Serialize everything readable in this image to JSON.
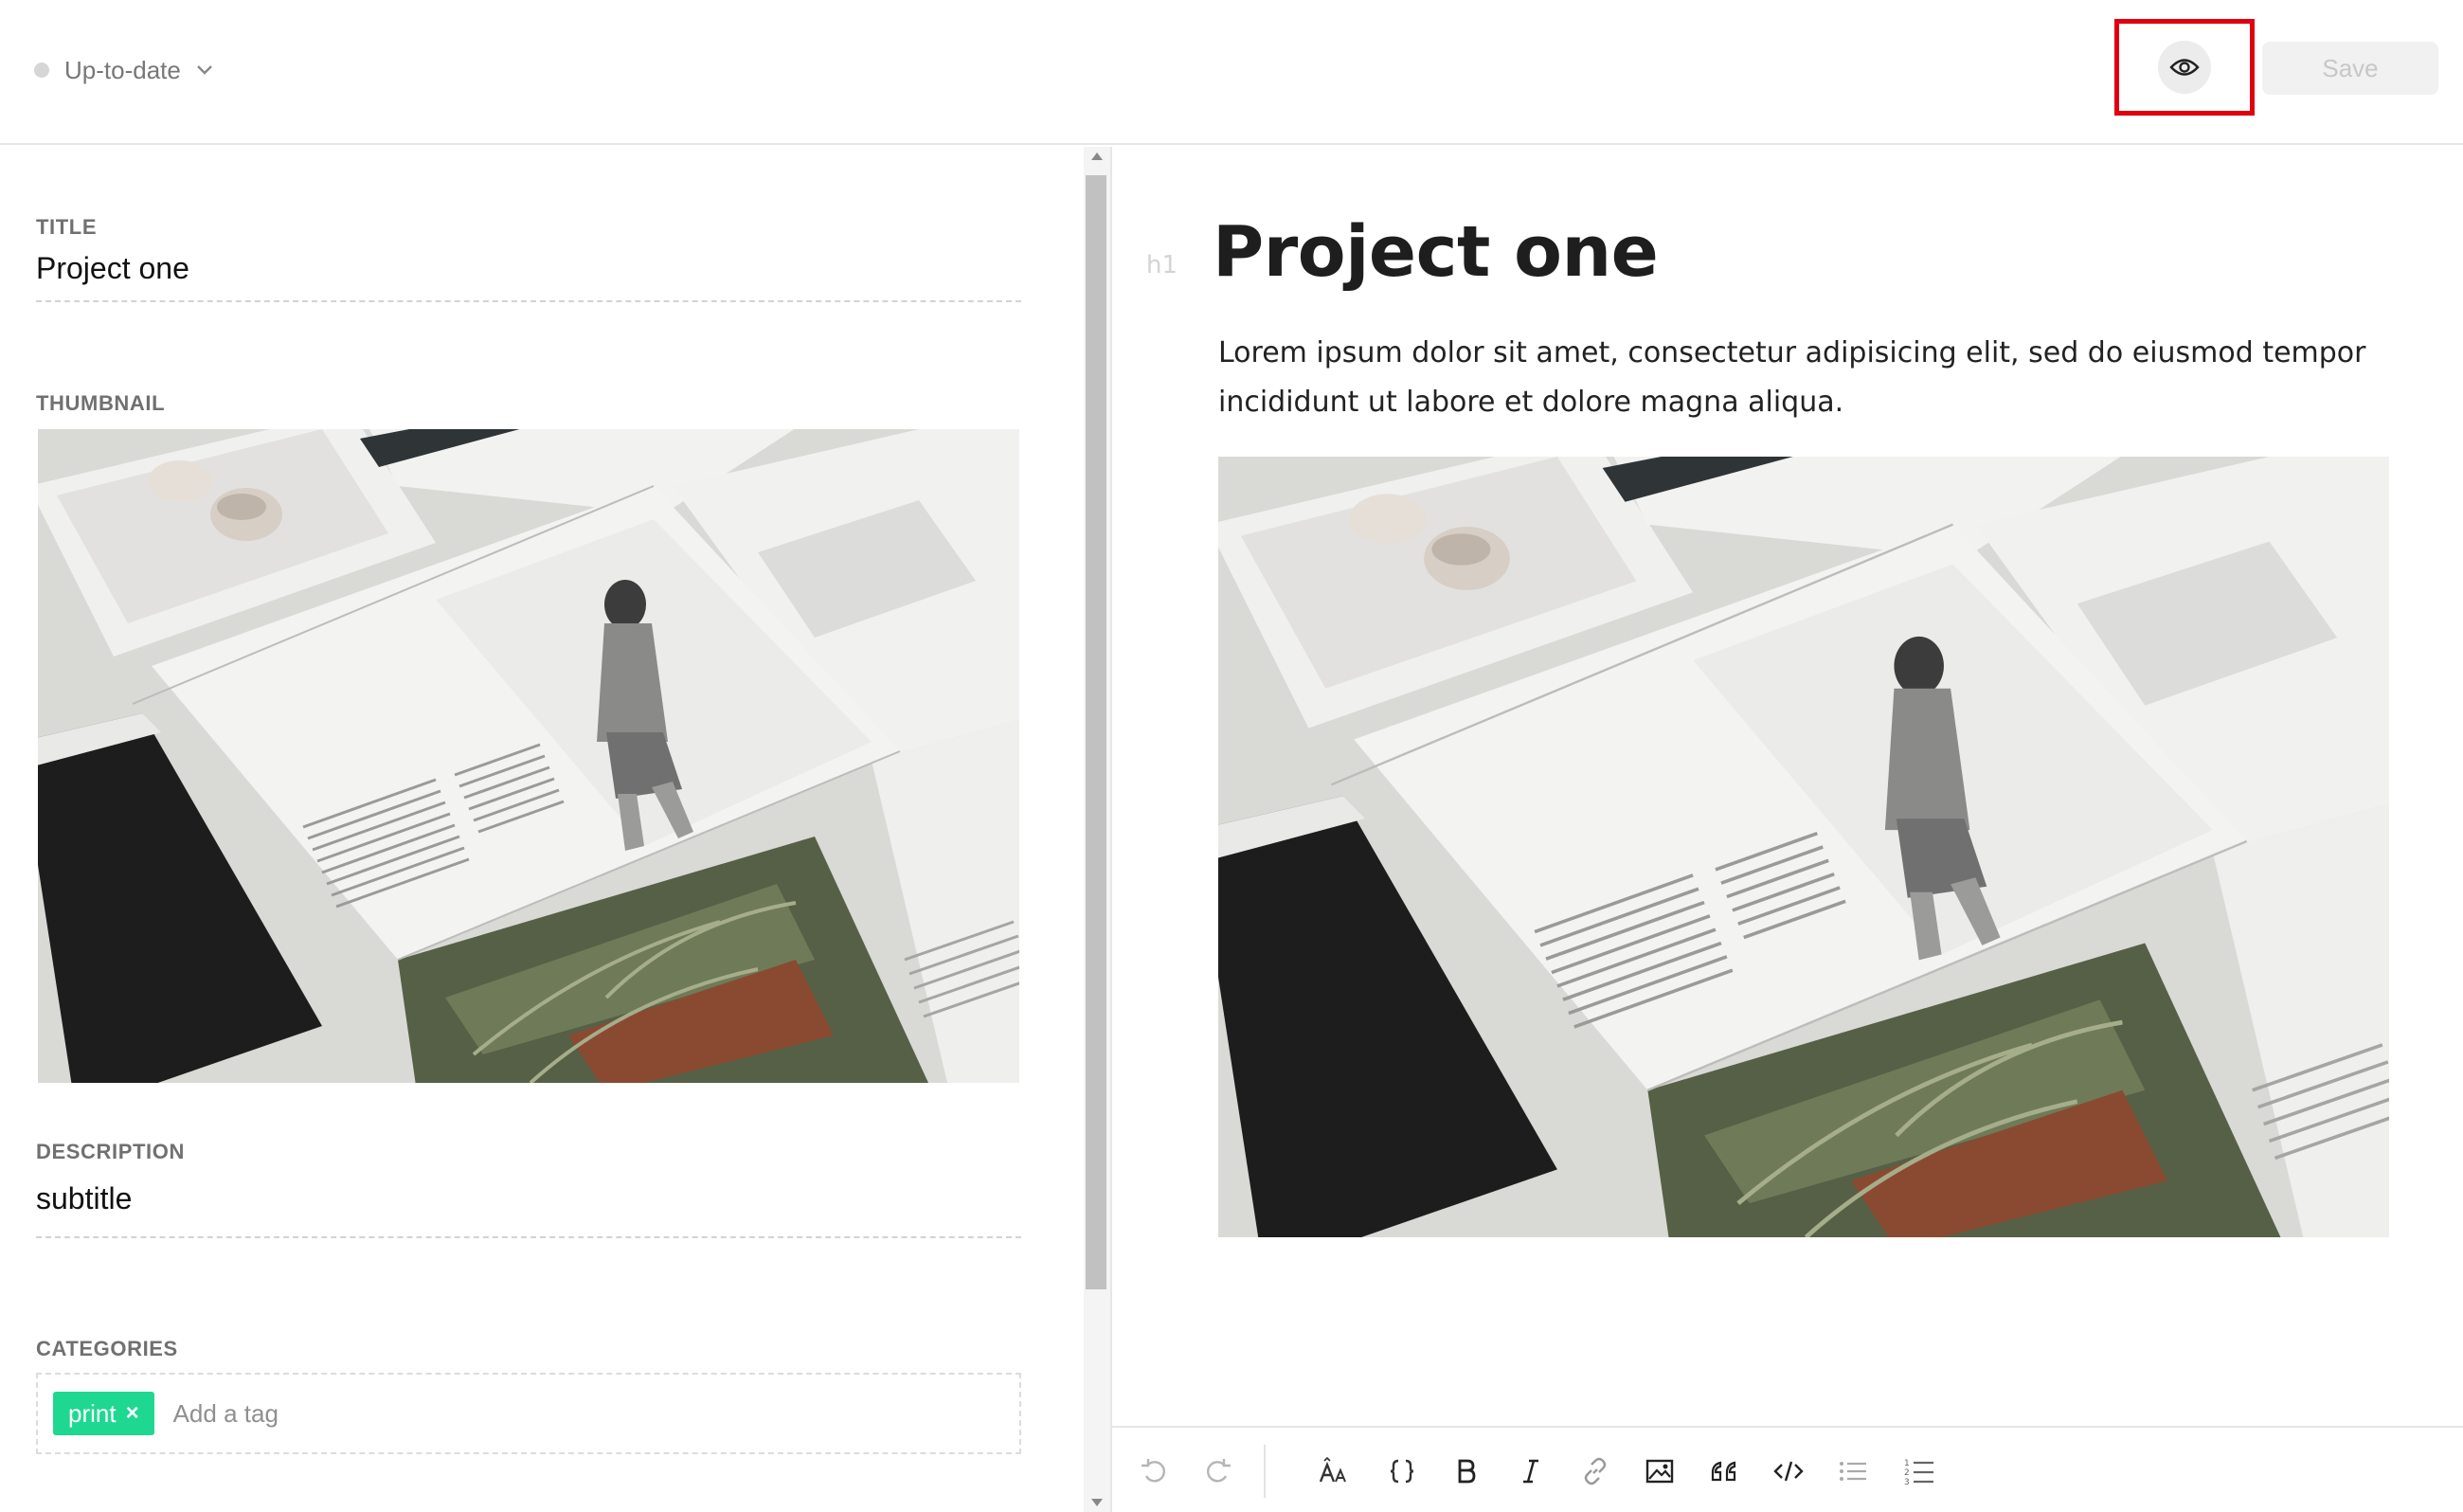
{
  "status": {
    "label": "Up-to-date",
    "dot_color": "#d6d6d6"
  },
  "header": {
    "preview_icon": "eye-icon",
    "save_label": "Save",
    "highlight_color": "#e0000f"
  },
  "fields": {
    "title": {
      "label": "TITLE",
      "value": "Project one"
    },
    "thumbnail": {
      "label": "THUMBNAIL"
    },
    "description": {
      "label": "DESCRIPTION",
      "value": "subtitle"
    },
    "categories": {
      "label": "CATEGORIES",
      "tags": [
        {
          "label": "print",
          "remove": "×"
        }
      ],
      "placeholder": "Add a tag",
      "tag_color": "#1ed891"
    }
  },
  "editor": {
    "heading_marker": "h1",
    "heading": "Project one",
    "paragraph": "Lorem ipsum dolor sit amet, consectetur adipisicing elit, sed do eiusmod tempor incididunt ut labore et dolore magna aliqua.",
    "image_description": "Editorial magazine spreads"
  },
  "toolbar": {
    "buttons": [
      {
        "name": "undo-icon",
        "enabled": false
      },
      {
        "name": "redo-icon",
        "enabled": false
      },
      {
        "name": "text-size-icon",
        "enabled": true
      },
      {
        "name": "braces-icon",
        "enabled": true
      },
      {
        "name": "bold-icon",
        "enabled": true
      },
      {
        "name": "italic-icon",
        "enabled": true
      },
      {
        "name": "link-icon",
        "enabled": true
      },
      {
        "name": "image-icon",
        "enabled": true
      },
      {
        "name": "quote-icon",
        "enabled": true
      },
      {
        "name": "code-icon",
        "enabled": true
      },
      {
        "name": "bullet-list-icon",
        "enabled": true
      },
      {
        "name": "numbered-list-icon",
        "enabled": true
      }
    ]
  }
}
